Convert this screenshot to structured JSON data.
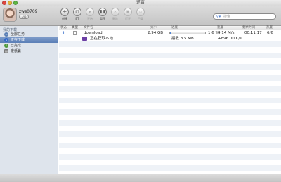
{
  "window": {
    "title": "迅雷"
  },
  "user": {
    "name": "zws0709",
    "badge": "VIP"
  },
  "toolbar": {
    "buttons": [
      {
        "icon": "plus-icon",
        "label": "新建"
      },
      {
        "icon": "bt-icon",
        "label": "BT"
      },
      {
        "icon": "play-icon",
        "label": "开始"
      },
      {
        "icon": "pause-icon",
        "label": "暂停"
      },
      {
        "icon": "trash-icon",
        "label": "删除"
      },
      {
        "icon": "open-icon",
        "label": "打开"
      },
      {
        "icon": "folder-icon",
        "label": "目录"
      }
    ]
  },
  "search": {
    "placeholder": "搜索"
  },
  "sidebar": {
    "heading": "我的下载",
    "items": [
      {
        "label": "全部任务"
      },
      {
        "label": "正在下载"
      },
      {
        "label": "已完成"
      },
      {
        "label": "废纸篓"
      }
    ]
  },
  "table": {
    "columns": [
      "状态",
      "类型",
      "文件名",
      "大小",
      "进度",
      "速度",
      "剩余时间",
      "热度"
    ],
    "task": {
      "name": "download",
      "size": "2.94 GB",
      "progress_text": "1.6 %",
      "progress": 0.016,
      "speed": "4.14 M/s",
      "remaining": "00:11:17",
      "heat": "6/6"
    },
    "subtask": {
      "name": "正在获取本地...",
      "received": "接收 8.5 MB",
      "speed_delta": "+896.00 K/s"
    }
  },
  "colors": {
    "selection": "#5b7fb7",
    "progress": "#4f82d1",
    "sidebar": "#dee4ec"
  }
}
